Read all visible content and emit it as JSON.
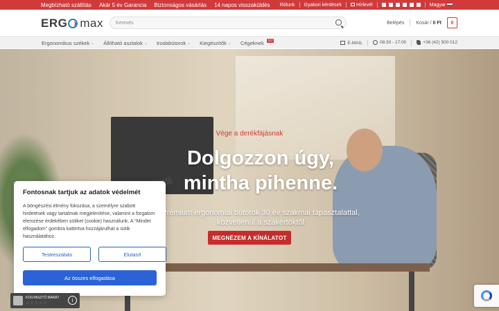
{
  "topbar": {
    "promos": [
      "Megbízható szállítás",
      "Akár 5 év Garancia",
      "Biztonságos vásárlás",
      "14 napos visszaküldés"
    ],
    "links": {
      "about": "Rólunk",
      "faq": "Gyakori kérdések",
      "newsletter": "Hírlevél",
      "language": "Magyar"
    },
    "social_icons": [
      "facebook-icon",
      "instagram-icon",
      "x-icon",
      "youtube-icon",
      "pinterest-icon",
      "linkedin-icon"
    ]
  },
  "header": {
    "logo": {
      "erg": "ERG",
      "max": "max"
    },
    "search": {
      "placeholder": "Keresés"
    },
    "login": "Belépés",
    "cart": {
      "label": "Kosár",
      "separator": "/",
      "total": "0 Ft",
      "count": "0"
    }
  },
  "nav": {
    "items": [
      {
        "label": "Ergonomikus székek"
      },
      {
        "label": "Állítható asztalok"
      },
      {
        "label": "Irodabútorok"
      },
      {
        "label": "Kiegészítők"
      },
      {
        "label": "Cégeknek"
      }
    ],
    "new_badge": "ÚJ",
    "contact": {
      "email": "E-MAIL",
      "hours": "08:30 - 17:00",
      "phone": "+36 (42) 500 012"
    }
  },
  "hero": {
    "subtitle": "Vége a derékfájásnak",
    "title_line1": "Dolgozzon úgy,",
    "title_line2": "mintha pihenne.",
    "desc_line1": "Prémium ergonómiai bútorok 30 év szakmai tapasztalattal,",
    "desc_line2": "közvetlenül a szakértőktől",
    "cta": "MEGNÉZEM A KÍNÁLATOT"
  },
  "cookie": {
    "title": "Fontosnak tartjuk az adatok védelmét",
    "text": "A böngészési élmény fokozása, a személyre szabott hirdetések vagy tartalmak megjelenítése, valamint a forgalom elemzése érdekében sütiket (cookie) használunk. A \"Mindet elfogadom\" gombra kattintva hozzájárulhat a sütik használatához.",
    "customize": "Testreszabás",
    "reject": "Elutasít",
    "accept_all": "Az összes elfogadása"
  },
  "badge": {
    "title": "FOGYASZTÓ BARÁT",
    "stars": "☆☆☆☆☆",
    "info": "i"
  },
  "colors": {
    "brand_red": "#d03a3a",
    "accept_blue": "#2b62d6"
  }
}
